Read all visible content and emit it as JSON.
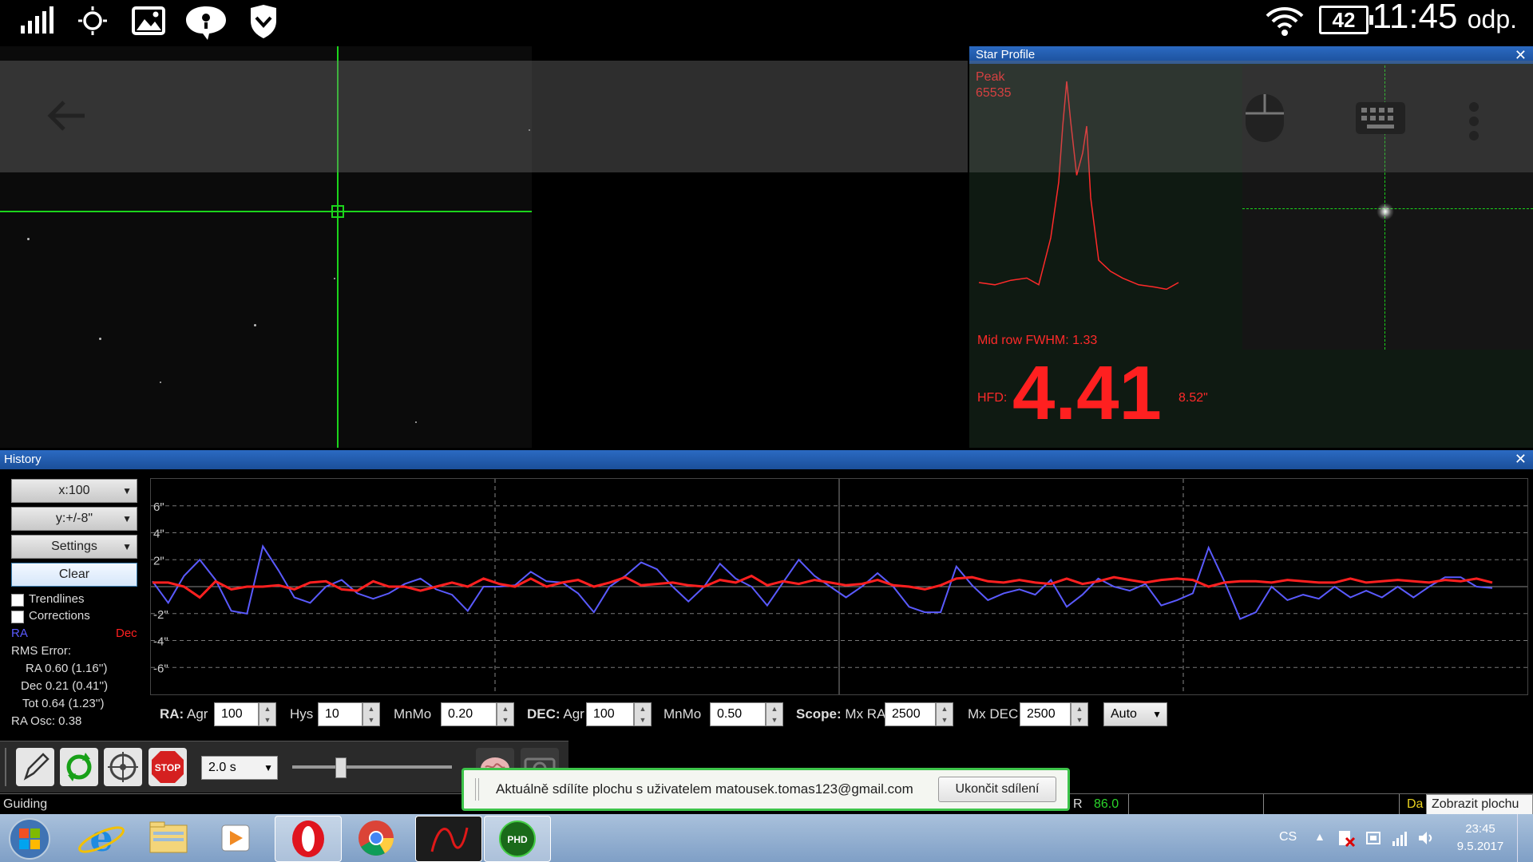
{
  "statusbar": {
    "icons": [
      "signal-icon",
      "brightness-icon",
      "gallery-icon",
      "chat-icon",
      "shield-icon",
      "wifi-icon"
    ],
    "battery": "42",
    "time": "11:45",
    "time_suffix": "odp."
  },
  "star_profile": {
    "title": "Star Profile",
    "peak_label": "Peak",
    "peak_value": "65535",
    "fwhm": "Mid row FWHM: 1.33",
    "hfd_label": "HFD:",
    "hfd_value": "4.41",
    "hfd_arcsec": "8.52\"",
    "profile_points": [
      [
        0,
        0.1
      ],
      [
        8,
        0.09
      ],
      [
        16,
        0.11
      ],
      [
        24,
        0.12
      ],
      [
        30,
        0.09
      ],
      [
        36,
        0.3
      ],
      [
        40,
        0.55
      ],
      [
        42,
        0.8
      ],
      [
        44,
        1.0
      ],
      [
        46,
        0.82
      ],
      [
        49,
        0.58
      ],
      [
        52,
        0.68
      ],
      [
        54,
        0.8
      ],
      [
        56,
        0.48
      ],
      [
        60,
        0.2
      ],
      [
        66,
        0.15
      ],
      [
        72,
        0.12
      ],
      [
        80,
        0.09
      ],
      [
        88,
        0.08
      ],
      [
        94,
        0.07
      ],
      [
        100,
        0.1
      ]
    ],
    "colors": {
      "accent": "#ff2a2a",
      "window": "#0f1a12"
    }
  },
  "history": {
    "title": "History",
    "x_scale": "x:100",
    "y_scale": "y:+/-8\"",
    "settings": "Settings",
    "clear": "Clear",
    "trendlines": "Trendlines",
    "corrections": "Corrections",
    "ra_label": "RA",
    "dec_label": "Dec",
    "rms_title": "RMS Error:",
    "rms_ra": "RA 0.60 (1.16'')",
    "rms_dec": "Dec 0.21 (0.41'')",
    "rms_tot": "Tot 0.64 (1.23'')",
    "ra_osc": "RA Osc: 0.38",
    "y_ticks": [
      "6\"",
      "4\"",
      "2\"",
      "-2\"",
      "-4\"",
      "-6\""
    ],
    "controls": {
      "ra_label": "RA:",
      "agr_label": "Agr",
      "ra_agr": "100",
      "hys_label": "Hys",
      "hys": "10",
      "mnmo_label": "MnMo",
      "ra_mnmo": "0.20",
      "dec_label": "DEC:",
      "dec_agr": "100",
      "dec_mnmo": "0.50",
      "scope_label": "Scope:",
      "mxra_label": "Mx RA",
      "mxra": "2500",
      "mxdec_label": "Mx DEC",
      "mxdec": "2500",
      "mode": "Auto"
    },
    "colors": {
      "ra": "#5a5aff",
      "dec": "#ff2020"
    }
  },
  "chart_data": {
    "type": "line",
    "ylim": [
      -8,
      8
    ],
    "series": [
      {
        "name": "RA",
        "values": [
          0.4,
          -1.2,
          0.8,
          2.0,
          0.5,
          -1.8,
          -2.0,
          3.0,
          1.2,
          -0.8,
          -1.2,
          0.0,
          0.5,
          -0.5,
          -0.9,
          -0.5,
          0.2,
          0.6,
          -0.2,
          -0.6,
          -1.8,
          0.0,
          0.0,
          0.1,
          1.1,
          0.4,
          0.3,
          -0.5,
          -1.9,
          0.0,
          0.8,
          1.8,
          1.3,
          0.0,
          -1.1,
          0.0,
          1.7,
          0.6,
          0.0,
          -1.4,
          0.3,
          2.0,
          0.8,
          0.0,
          -0.8,
          0.0,
          1.0,
          0.0,
          -1.5,
          -1.9,
          -1.9,
          1.5,
          0.1,
          -1.0,
          -0.5,
          -0.2,
          -0.6,
          0.5,
          -1.5,
          -0.6,
          0.6,
          0.0,
          -0.3,
          0.2,
          -1.4,
          -1.0,
          -0.5,
          2.9,
          0.4,
          -2.4,
          -1.9,
          0.0,
          -1.0,
          -0.6,
          -0.9,
          0.0,
          -0.8,
          -0.3,
          -0.8,
          0.0,
          -0.8,
          0.0,
          0.7,
          0.7,
          0.0,
          -0.1
        ]
      },
      {
        "name": "Dec",
        "values": [
          0.3,
          0.3,
          0.0,
          -0.8,
          0.4,
          -0.2,
          0.0,
          0.0,
          0.1,
          -0.2,
          0.3,
          0.4,
          -0.2,
          -0.3,
          0.4,
          0.0,
          0.0,
          -0.3,
          0.0,
          0.3,
          0.0,
          0.6,
          0.2,
          0.0,
          0.6,
          0.0,
          0.3,
          0.5,
          0.0,
          0.3,
          0.7,
          0.1,
          0.2,
          0.3,
          0.1,
          0.0,
          0.5,
          0.3,
          0.8,
          0.1,
          0.4,
          0.2,
          0.5,
          0.3,
          0.1,
          0.2,
          0.5,
          0.1,
          0.0,
          -0.2,
          0.1,
          0.6,
          0.7,
          0.4,
          0.3,
          0.5,
          0.3,
          0.2,
          0.6,
          0.2,
          0.4,
          0.7,
          0.5,
          0.3,
          0.5,
          0.6,
          0.5,
          0.0,
          0.3,
          0.4,
          0.4,
          0.3,
          0.5,
          0.4,
          0.3,
          0.3,
          0.6,
          0.3,
          0.4,
          0.5,
          0.4,
          0.3,
          0.5,
          0.4,
          0.6,
          0.3
        ]
      }
    ]
  },
  "toolbar": {
    "exposure": "2.0 s"
  },
  "status": {
    "mode": "Guiding",
    "r_label": "R",
    "r_value": "86.0",
    "da_label": "Da",
    "show_desktop": "Zobrazit plochu"
  },
  "share_notice": {
    "text": "Aktuálně sdílíte plochu s uživatelem matousek.tomas123@gmail.com",
    "stop_button": "Ukončit sdílení"
  },
  "taskbar": {
    "lang": "CS",
    "time": "23:45",
    "date": "9.5.2017"
  }
}
